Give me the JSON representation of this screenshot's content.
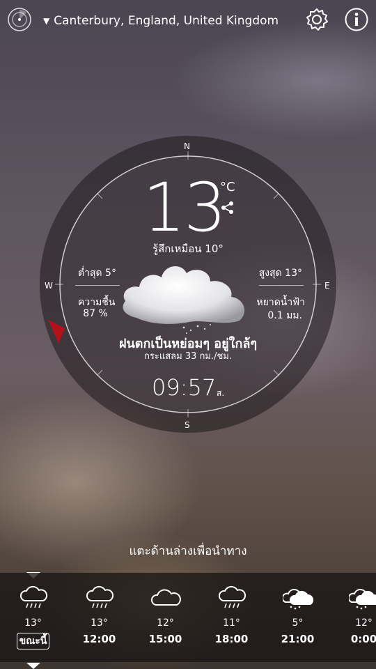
{
  "header": {
    "location": "Canterbury, England, United Kingdom",
    "radar_icon": "radar-icon",
    "settings_icon": "gear-icon",
    "info_icon": "info-icon"
  },
  "dial": {
    "north": "N",
    "south": "S",
    "east": "E",
    "west": "W",
    "temperature": "13",
    "unit": "°C",
    "feels_like": "รู้สึกเหมือน 10°",
    "low": "ต่ำสุด 5°",
    "high": "สูงสุด 13°",
    "humidity_label": "ความชื้น",
    "humidity_value": "87 %",
    "precip_label": "หยาดน้ำฟ้า",
    "precip_value": "0.1 มม.",
    "condition": "ฝนตกเป็นหย่อมๆ อยู่ใกล้ๆ",
    "wind": "กระแสลม 33 กม./ชม.",
    "time": "09:57",
    "ampm": "ส.",
    "accent_color": "#b3121a"
  },
  "hint": "แตะด้านล่างเพื่อนำทาง",
  "hourly": [
    {
      "temp": "13°",
      "label": "ขณะนี้",
      "icon": "rain-cloud-icon"
    },
    {
      "temp": "13°",
      "label": "12:00",
      "icon": "rain-cloud-icon"
    },
    {
      "temp": "12°",
      "label": "15:00",
      "icon": "cloud-icon"
    },
    {
      "temp": "11°",
      "label": "18:00",
      "icon": "rain-cloud-icon"
    },
    {
      "temp": "5°",
      "label": "21:00",
      "icon": "snow-cloud-icon"
    },
    {
      "temp": "12°",
      "label": "0:00",
      "icon": "snow-cloud-icon"
    }
  ]
}
